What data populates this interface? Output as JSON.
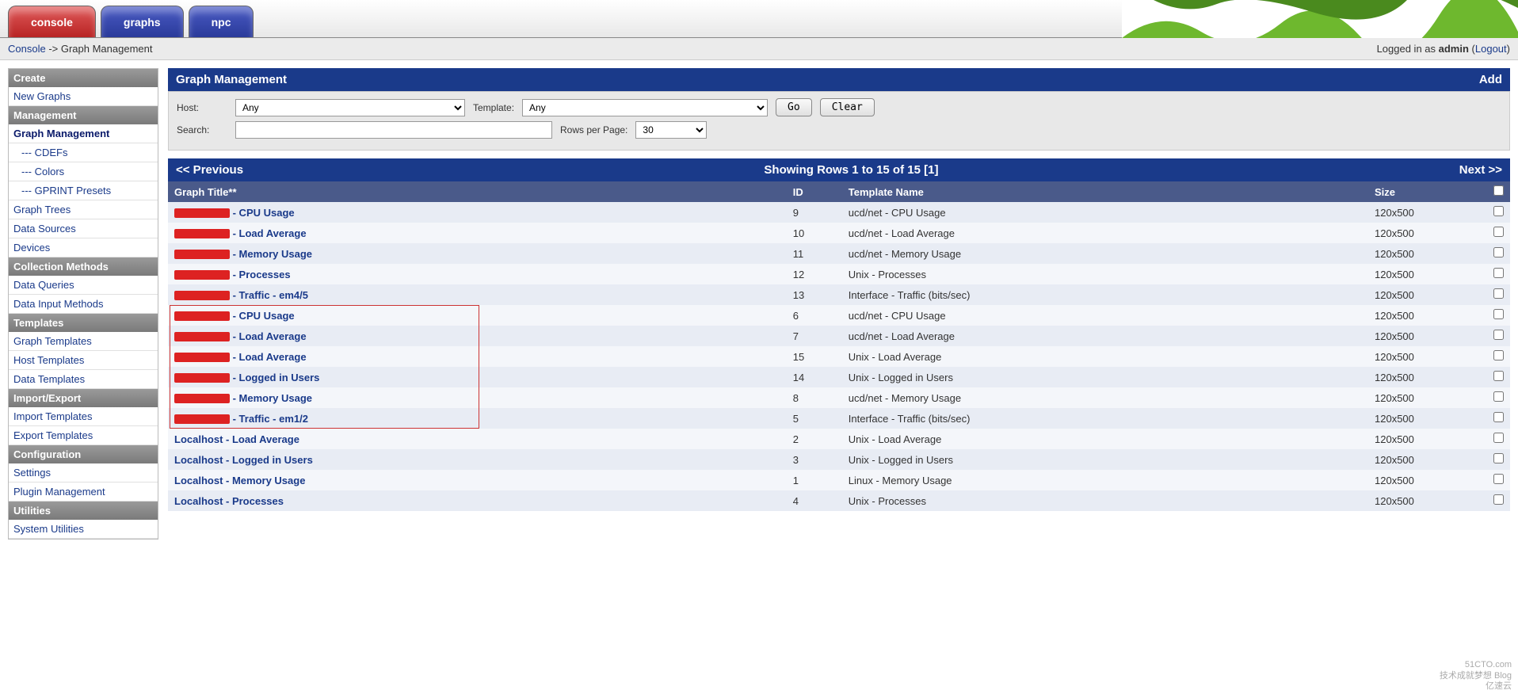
{
  "tabs": {
    "console": "console",
    "graphs": "graphs",
    "npc": "npc"
  },
  "breadcrumb": {
    "root": "Console",
    "sep": " -> ",
    "leaf": "Graph Management"
  },
  "login": {
    "prefix": "Logged in as ",
    "user": "admin",
    "logout": "Logout"
  },
  "sidebar": {
    "sections": [
      {
        "header": "Create",
        "items": [
          {
            "label": "New Graphs"
          }
        ]
      },
      {
        "header": "Management",
        "items": [
          {
            "label": "Graph Management",
            "active": true
          },
          {
            "label": "--- CDEFs",
            "sub": true
          },
          {
            "label": "--- Colors",
            "sub": true
          },
          {
            "label": "--- GPRINT Presets",
            "sub": true
          },
          {
            "label": "Graph Trees"
          },
          {
            "label": "Data Sources"
          },
          {
            "label": "Devices"
          }
        ]
      },
      {
        "header": "Collection Methods",
        "items": [
          {
            "label": "Data Queries"
          },
          {
            "label": "Data Input Methods"
          }
        ]
      },
      {
        "header": "Templates",
        "items": [
          {
            "label": "Graph Templates"
          },
          {
            "label": "Host Templates"
          },
          {
            "label": "Data Templates"
          }
        ]
      },
      {
        "header": "Import/Export",
        "items": [
          {
            "label": "Import Templates"
          },
          {
            "label": "Export Templates"
          }
        ]
      },
      {
        "header": "Configuration",
        "items": [
          {
            "label": "Settings"
          },
          {
            "label": "Plugin Management"
          }
        ]
      },
      {
        "header": "Utilities",
        "items": [
          {
            "label": "System Utilities"
          }
        ]
      }
    ]
  },
  "panel": {
    "title": "Graph Management",
    "add": "Add"
  },
  "filter": {
    "host_label": "Host:",
    "host_value": "Any",
    "template_label": "Template:",
    "template_value": "Any",
    "go": "Go",
    "clear": "Clear",
    "search_label": "Search:",
    "search_value": "",
    "rows_label": "Rows per Page:",
    "rows_value": "30"
  },
  "pager": {
    "prev": "<< Previous",
    "showing": "Showing Rows 1 to 15 of 15 [",
    "page": "1",
    "showing_end": "]",
    "next": "Next >>"
  },
  "columns": {
    "title": "Graph Title**",
    "id": "ID",
    "template": "Template Name",
    "size": "Size"
  },
  "rows": [
    {
      "redacted": true,
      "suffix": " - CPU Usage",
      "id": "9",
      "template": "ucd/net - CPU Usage",
      "size": "120x500"
    },
    {
      "redacted": true,
      "suffix": " - Load Average",
      "id": "10",
      "template": "ucd/net - Load Average",
      "size": "120x500"
    },
    {
      "redacted": true,
      "suffix": " - Memory Usage",
      "id": "11",
      "template": "ucd/net - Memory Usage",
      "size": "120x500"
    },
    {
      "redacted": true,
      "suffix": " - Processes",
      "id": "12",
      "template": "Unix - Processes",
      "size": "120x500"
    },
    {
      "redacted": true,
      "suffix": " - Traffic - em4/5",
      "id": "13",
      "template": "Interface - Traffic (bits/sec)",
      "size": "120x500"
    },
    {
      "redacted": true,
      "suffix": " - CPU Usage",
      "id": "6",
      "template": "ucd/net - CPU Usage",
      "size": "120x500",
      "boxstart": true
    },
    {
      "redacted": true,
      "suffix": " - Load Average",
      "id": "7",
      "template": "ucd/net - Load Average",
      "size": "120x500"
    },
    {
      "redacted": true,
      "suffix": " - Load Average",
      "id": "15",
      "template": "Unix - Load Average",
      "size": "120x500"
    },
    {
      "redacted": true,
      "suffix": " - Logged in Users",
      "id": "14",
      "template": "Unix - Logged in Users",
      "size": "120x500"
    },
    {
      "redacted": true,
      "suffix": " - Memory Usage",
      "id": "8",
      "template": "ucd/net - Memory Usage",
      "size": "120x500"
    },
    {
      "redacted": true,
      "suffix": " - Traffic - em1/2",
      "id": "5",
      "template": "Interface - Traffic (bits/sec)",
      "size": "120x500",
      "boxend": true
    },
    {
      "title": "Localhost - Load Average",
      "id": "2",
      "template": "Unix - Load Average",
      "size": "120x500"
    },
    {
      "title": "Localhost - Logged in Users",
      "id": "3",
      "template": "Unix - Logged in Users",
      "size": "120x500"
    },
    {
      "title": "Localhost - Memory Usage",
      "id": "1",
      "template": "Linux - Memory Usage",
      "size": "120x500"
    },
    {
      "title": "Localhost - Processes",
      "id": "4",
      "template": "Unix - Processes",
      "size": "120x500"
    }
  ],
  "watermark": {
    "l1": "51CTO.com",
    "l2": "技术成就梦想  Blog",
    "l3": "亿速云"
  }
}
